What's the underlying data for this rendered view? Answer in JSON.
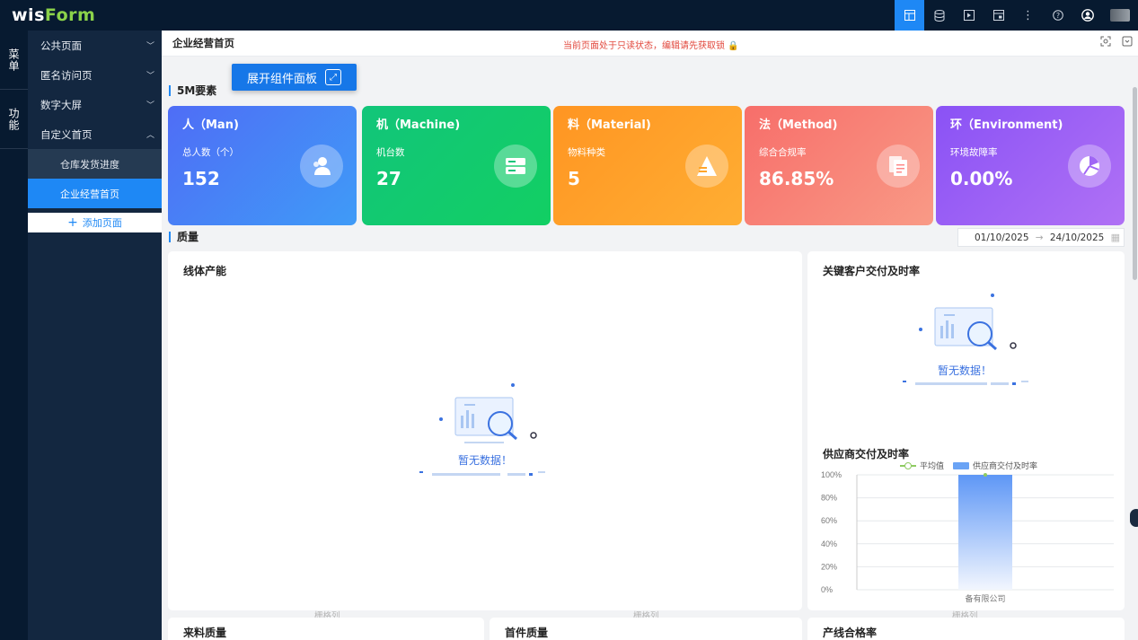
{
  "app": {
    "logo_w": "wis",
    "logo_f": "Form",
    "toolbar_icons": [
      "dashboard-icon",
      "database-icon",
      "media-icon",
      "form-icon",
      "more-icon",
      "help-icon",
      "user-icon"
    ]
  },
  "rail": {
    "items": [
      "菜单",
      "功能"
    ]
  },
  "sidebar": {
    "items": [
      {
        "label": "公共页面"
      },
      {
        "label": "匿名访问页"
      },
      {
        "label": "数字大屏"
      },
      {
        "label": "自定义首页"
      }
    ],
    "subitems": [
      {
        "label": "仓库发货进度"
      },
      {
        "label": "企业经营首页"
      }
    ],
    "add_label": "添加页面"
  },
  "header": {
    "title": "企业经营首页",
    "notice": "当前页面处于只读状态，编辑请先获取锁"
  },
  "expand_button": "展开组件面板",
  "section_5m": "5M要素",
  "cards": [
    {
      "title": "人（Man)",
      "label": "总人数（个）",
      "value": "152",
      "color": "#4f6df6"
    },
    {
      "title": "机（Machine)",
      "label": "机台数",
      "value": "27",
      "color": "#12c57a"
    },
    {
      "title": "料（Material)",
      "label": "物料种类",
      "value": "5",
      "color": "#ff9522"
    },
    {
      "title": "法（Method)",
      "label": "综合合规率",
      "value": "86.85%",
      "color": "#f76e6a"
    },
    {
      "title": "环（Environment)",
      "label": "环境故障率",
      "value": "0.00%",
      "color": "#8a52f5"
    }
  ],
  "section_quality": "质量",
  "date_range": {
    "start": "01/10/2025",
    "end": "24/10/2025"
  },
  "panels": {
    "line_capacity": {
      "title": "线体产能",
      "empty": "暂无数据！"
    },
    "key_customer": {
      "title": "关键客户交付及时率",
      "empty": "暂无数据！"
    },
    "supplier": {
      "title": "供应商交付及时率"
    },
    "incoming": {
      "title": "来料质量"
    },
    "first_piece": {
      "title": "首件质量"
    },
    "line_pass": {
      "title": "产线合格率"
    }
  },
  "grid_label": "栅格列",
  "chart_data": {
    "type": "bar",
    "categories": [
      "备有限公司"
    ],
    "series": [
      {
        "name": "供应商交付及时率",
        "values": [
          100
        ]
      },
      {
        "name": "平均值",
        "values": [
          100
        ]
      }
    ],
    "yticks": [
      "0%",
      "20%",
      "40%",
      "60%",
      "80%",
      "100%"
    ],
    "ylim": [
      0,
      100
    ],
    "legend": "top-center"
  }
}
